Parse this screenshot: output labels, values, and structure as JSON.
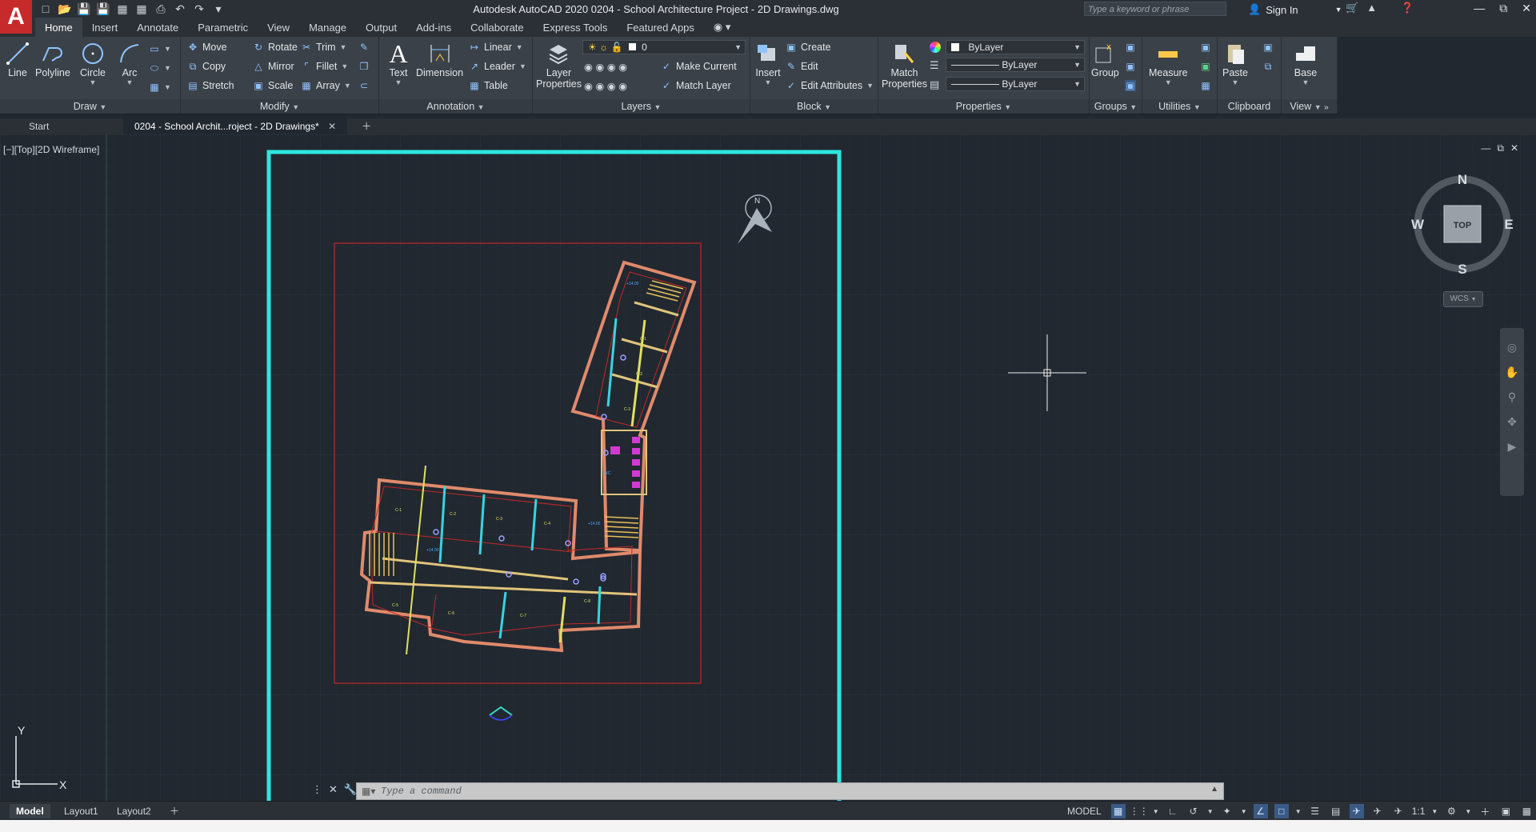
{
  "title_bar": {
    "app_logo": "A",
    "title": "Autodesk AutoCAD 2020    0204 - School Architecture Project - 2D Drawings.dwg",
    "search_placeholder": "Type a keyword or phrase",
    "sign_in": "Sign In"
  },
  "ribbon_tabs": [
    "Home",
    "Insert",
    "Annotate",
    "Parametric",
    "View",
    "Manage",
    "Output",
    "Add-ins",
    "Collaborate",
    "Express Tools",
    "Featured Apps"
  ],
  "ribbon": {
    "draw": {
      "title": "Draw",
      "line": "Line",
      "polyline": "Polyline",
      "circle": "Circle",
      "arc": "Arc"
    },
    "modify": {
      "title": "Modify",
      "move": "Move",
      "rotate": "Rotate",
      "trim": "Trim",
      "copy": "Copy",
      "mirror": "Mirror",
      "fillet": "Fillet",
      "stretch": "Stretch",
      "scale": "Scale",
      "array": "Array"
    },
    "annotation": {
      "title": "Annotation",
      "text": "Text",
      "dimension": "Dimension",
      "linear": "Linear",
      "leader": "Leader",
      "table": "Table"
    },
    "layers": {
      "title": "Layers",
      "layer_properties_1": "Layer",
      "layer_properties_2": "Properties",
      "current_layer": "0",
      "make_current": "Make Current",
      "match_layer": "Match Layer"
    },
    "block": {
      "title": "Block",
      "insert": "Insert",
      "create": "Create",
      "edit": "Edit",
      "edit_attributes": "Edit Attributes"
    },
    "properties": {
      "title": "Properties",
      "match_1": "Match",
      "match_2": "Properties",
      "color": "ByLayer",
      "linetype": "ByLayer",
      "lineweight": "ByLayer"
    },
    "groups": {
      "title": "Groups",
      "group": "Group"
    },
    "utilities": {
      "title": "Utilities",
      "measure": "Measure"
    },
    "clipboard": {
      "title": "Clipboard",
      "paste": "Paste"
    },
    "view": {
      "title": "View",
      "base": "Base"
    }
  },
  "doc_tabs": {
    "start": "Start",
    "active": "0204 - School Archit...roject - 2D Drawings*"
  },
  "viewport": {
    "label": "[−][Top][2D Wireframe]",
    "viewcube": {
      "n": "N",
      "s": "S",
      "e": "E",
      "w": "W",
      "face": "TOP"
    },
    "wcs": "WCS",
    "ucs_x": "X",
    "ucs_y": "Y",
    "north_mark": "N"
  },
  "command_line": {
    "placeholder": "Type a command"
  },
  "status_bar": {
    "layout_tabs": [
      "Model",
      "Layout1",
      "Layout2"
    ],
    "model": "MODEL",
    "scale": "1:1"
  },
  "colors": {
    "background": "#212830",
    "frame": "#2ee6e0",
    "site_boundary": "#c02828",
    "app_red": "#c62a2a"
  }
}
